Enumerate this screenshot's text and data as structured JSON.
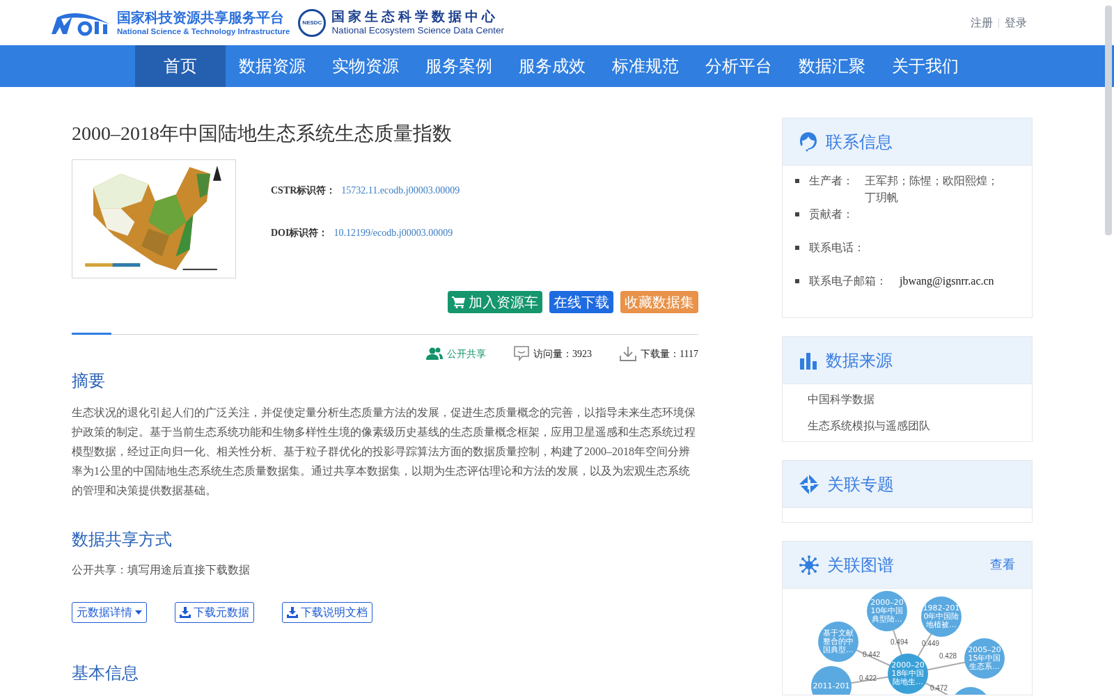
{
  "header": {
    "platform_name": "国家科技资源共享服务平台",
    "platform_subtitle": "National Science & Technology Infrastructure",
    "center_badge": "NESDC",
    "center_name": "国家生态科学数据中心",
    "center_subtitle": "National Ecosystem Science Data Center",
    "auth_links": [
      "注册",
      "登录"
    ]
  },
  "nav": [
    {
      "label": "首页",
      "selected": true
    },
    {
      "label": "数据资源",
      "selected": false
    },
    {
      "label": "实物资源",
      "selected": false
    },
    {
      "label": "服务案例",
      "selected": false
    },
    {
      "label": "服务成效",
      "selected": false
    },
    {
      "label": "标准规范",
      "selected": false
    },
    {
      "label": "分析平台",
      "selected": false
    },
    {
      "label": "数据汇聚",
      "selected": false
    },
    {
      "label": "关于我们",
      "selected": false
    }
  ],
  "dataset": {
    "title": "2000–2018年中国陆地生态系统生态质量指数",
    "identifiers": [
      {
        "label": "CSTR标识符：",
        "value": "15732.11.ecodb.j00003.00009"
      },
      {
        "label": "DOI标识符：",
        "value": "10.12199/ecodb.j00003.00009"
      }
    ],
    "buttons": [
      {
        "label": "加入资源车",
        "kind": "cart"
      },
      {
        "label": "在线下载",
        "kind": "primary"
      },
      {
        "label": "收藏数据集",
        "kind": "warning"
      }
    ],
    "stats": [
      {
        "kind": "share",
        "label": "公开共享"
      },
      {
        "kind": "visits",
        "label": "访问量：",
        "value": "3923"
      },
      {
        "kind": "downloads",
        "label": "下载量：",
        "value": "1117"
      }
    ]
  },
  "abstract": {
    "heading": "摘要",
    "text": "生态状况的退化引起人们的广泛关注，并促使定量分析生态质量方法的发展，促进生态质量概念的完善，以指导未来生态环境保护政策的制定。基于当前生态系统功能和生物多样性生境的像素级历史基线的生态质量概念框架，应用卫星遥感和生态系统过程模型数据，经过正向归一化、相关性分析、基于粒子群优化的投影寻踪算法方面的数据质量控制，构建了2000–2018年空间分辨率为1公里的中国陆地生态系统生态质量数据集。通过共享本数据集，以期为生态评估理论和方法的发展，以及为宏观生态系统的管理和决策提供数据基础。"
  },
  "sharing": {
    "heading": "数据共享方式",
    "text": "公开共享：填写用途后直接下载数据",
    "buttons": [
      {
        "label": "元数据详情",
        "kind": "dropdown"
      },
      {
        "label": "下载元数据",
        "kind": "download"
      },
      {
        "label": "下载说明文档",
        "kind": "download"
      }
    ]
  },
  "basic_info": {
    "heading": "基本信息"
  },
  "sidebar": {
    "contact": {
      "title": "联系信息",
      "items": [
        {
          "label": "生产者：",
          "value": "王军邦；陈惺；欧阳熙煌；丁玥帆"
        },
        {
          "label": "贡献者："
        },
        {
          "label": "联系电话："
        },
        {
          "label": "联系电子邮箱：",
          "value": "jbwang@igsnrr.ac.cn"
        }
      ]
    },
    "sources": {
      "title": "数据来源",
      "items": [
        "中国科学数据",
        "生态系统模拟与遥感团队"
      ]
    },
    "topics": {
      "title": "关联专题"
    },
    "graph": {
      "title": "关联图谱",
      "link": "查看",
      "nodes": [
        {
          "lines": [
            "2000–20",
            "10年中国",
            "典型陆..."
          ],
          "edge_label": "0.494"
        },
        {
          "lines": [
            "1982-201",
            "0年中国陆",
            "地植被..."
          ],
          "edge_label": "0.449"
        },
        {
          "lines": [
            "基于文献",
            "整合的中",
            "国典型..."
          ],
          "edge_label": "0.442"
        },
        {
          "lines": [
            "2005–20",
            "15年中国",
            "生态系..."
          ],
          "edge_label": "0.428"
        },
        {
          "lines": [
            "2011-201"
          ],
          "edge_label": "0.422"
        },
        {
          "edge_label": "0.472"
        }
      ],
      "center": {
        "lines": [
          "2000–20",
          "18年中国",
          "陆地生..."
        ]
      }
    }
  }
}
